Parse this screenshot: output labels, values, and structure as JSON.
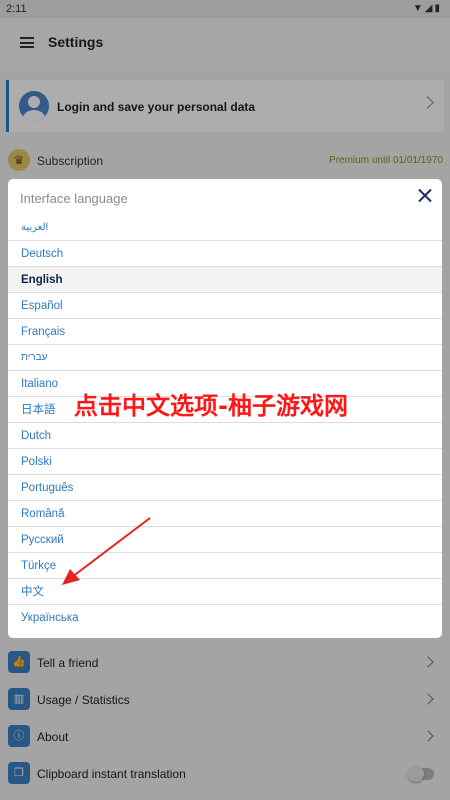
{
  "status_bar": {
    "time": "2:11",
    "icons": "▼◢▮"
  },
  "app_bar": {
    "title": "Settings",
    "menu_icon": "hamburger-icon"
  },
  "login_card": {
    "text": "Login and save your personal data"
  },
  "subscription": {
    "label": "Subscription",
    "status": "Premium until 01/01/1970"
  },
  "dialog": {
    "title": "Interface language",
    "languages": [
      "العربية",
      "Deutsch",
      "English",
      "Español",
      "Français",
      "עברית",
      "Italiano",
      "日本語",
      "Dutch",
      "Polski",
      "Português",
      "Română",
      "Русский",
      "Türkçe",
      "中文",
      "Українська"
    ],
    "selected": "English"
  },
  "bottom_rows": [
    {
      "label": "Tell a friend",
      "icon": "thumbs-up-icon",
      "glyph": "👍"
    },
    {
      "label": "Usage / Statistics",
      "icon": "bar-chart-icon",
      "glyph": "▥"
    },
    {
      "label": "About",
      "icon": "info-icon",
      "glyph": "ⓘ"
    },
    {
      "label": "Clipboard instant translation",
      "icon": "clipboard-icon",
      "glyph": "❐",
      "toggle": false
    }
  ],
  "overlay": {
    "watermark": "点击中文选项-柚子游戏网"
  },
  "colors": {
    "accent": "#2f7bc6",
    "link": "#2e79c2",
    "watermark": "#ff1717",
    "premium": "#a08429"
  }
}
